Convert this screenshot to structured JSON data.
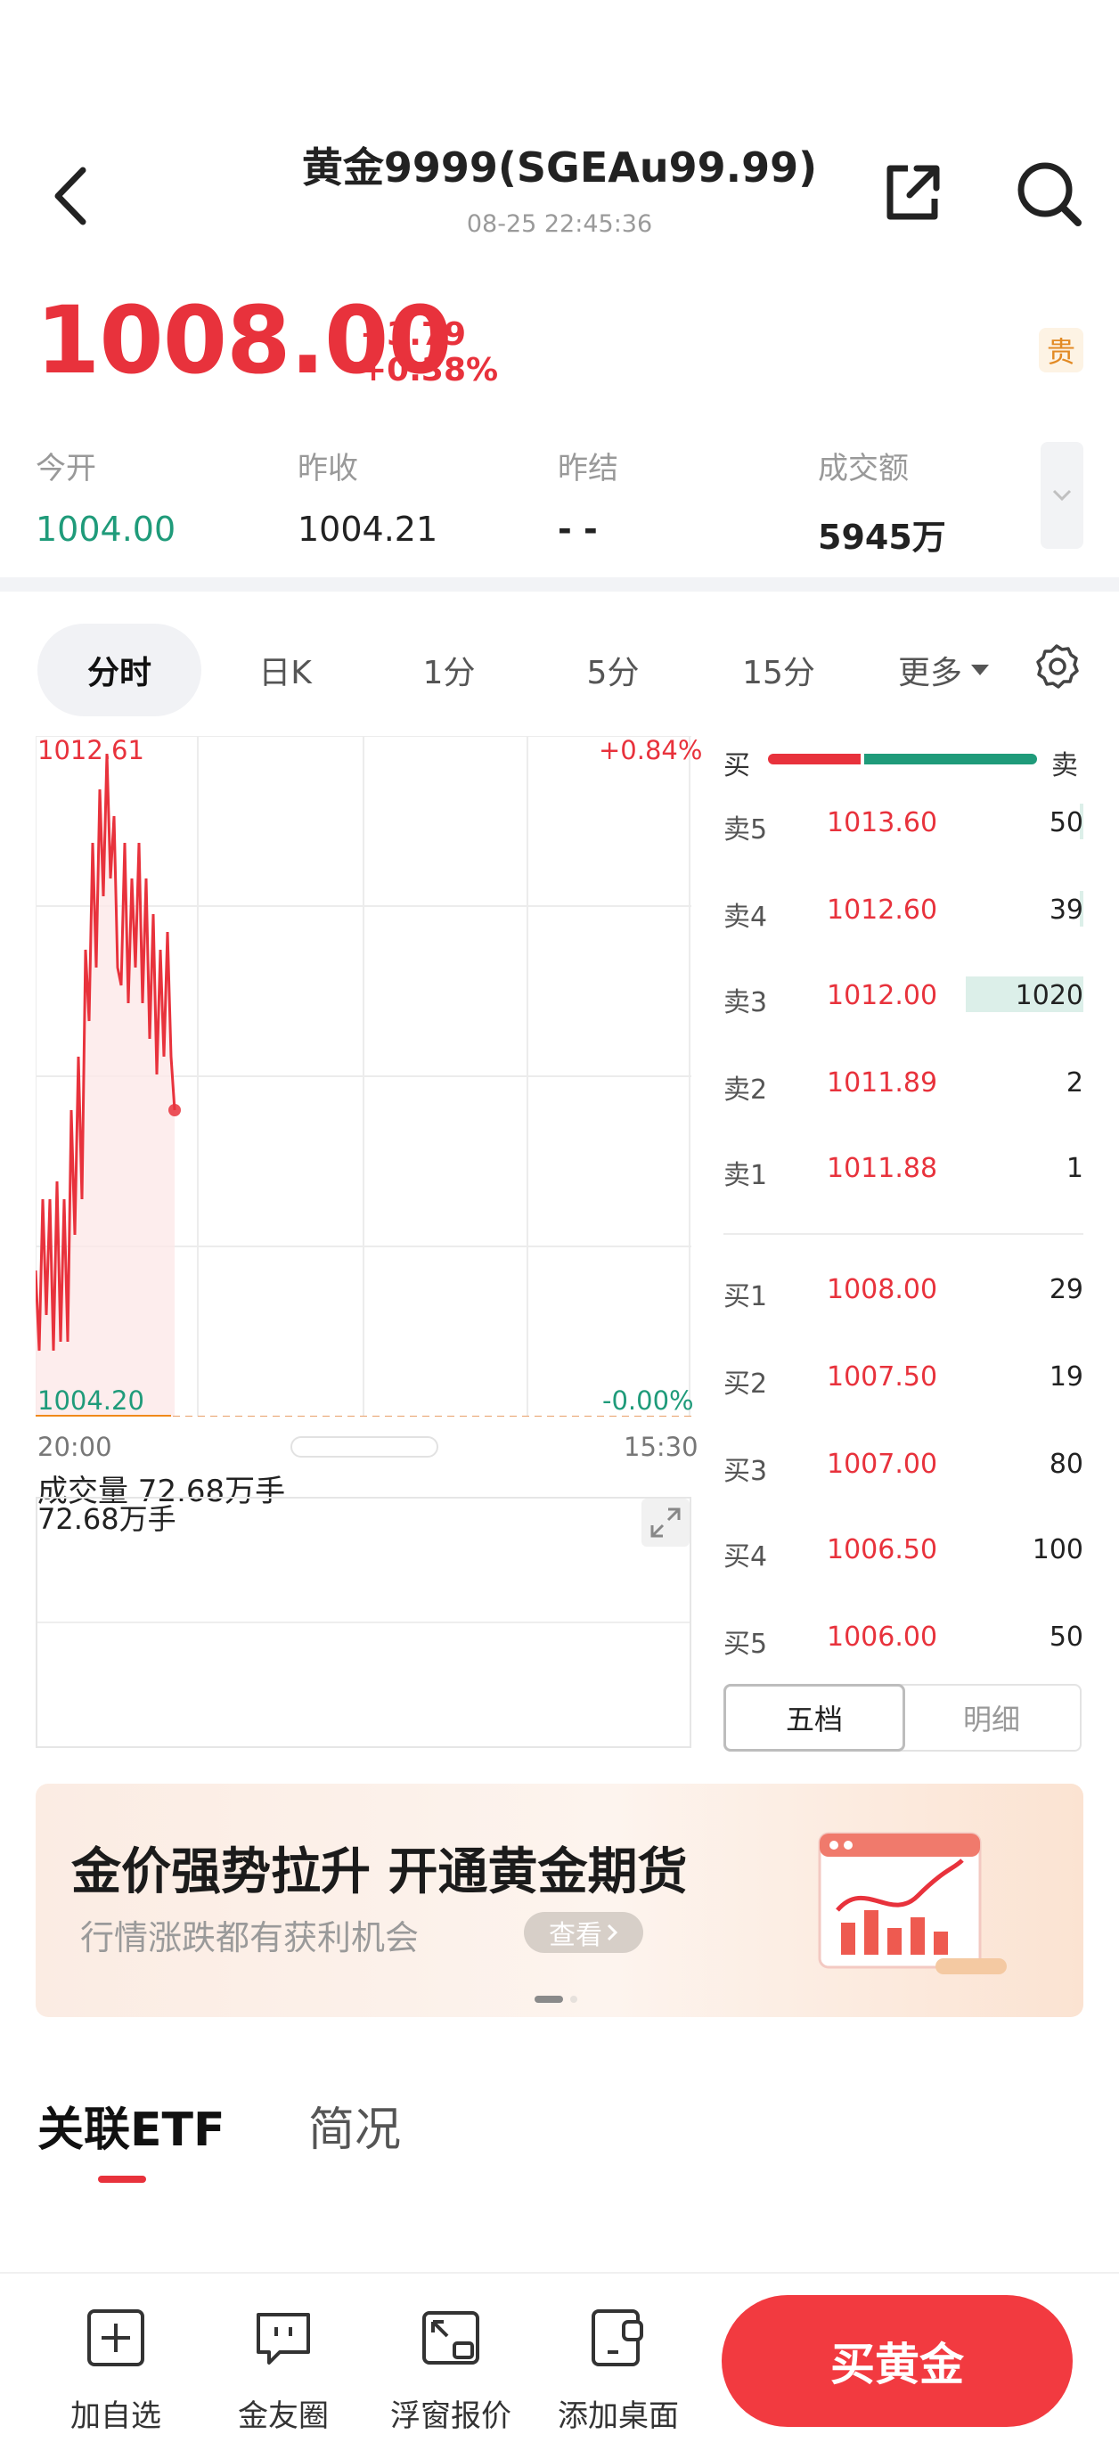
{
  "header": {
    "title": "黄金9999(SGEAu99.99)",
    "time": "08-25 22:45:36"
  },
  "quote": {
    "price": "1008.00",
    "change": "+3.79",
    "change_pct": "+0.38%",
    "badge": "贵",
    "price_color": "#e8323c"
  },
  "stats": [
    {
      "label": "今开",
      "value": "1004.00"
    },
    {
      "label": "昨收",
      "value": "1004.21"
    },
    {
      "label": "昨结",
      "value": "- -"
    },
    {
      "label": "成交额",
      "value": "5945万"
    }
  ],
  "tabs": [
    "分时",
    "日K",
    "1分",
    "5分",
    "15分",
    "更多"
  ],
  "chart": {
    "high_label": "1012.61",
    "high_pct": "+0.84%",
    "low_label": "1004.20",
    "low_pct": "-0.00%",
    "time_start": "20:00",
    "time_end": "15:30",
    "volume_title": "成交量 72.68万手",
    "volume_value": "72.68万手"
  },
  "orderbook": {
    "buy_label": "买",
    "sell_label": "卖",
    "asks": [
      {
        "label": "卖5",
        "price": "1013.60",
        "volume": "50",
        "depth": 0.05
      },
      {
        "label": "卖4",
        "price": "1012.60",
        "volume": "39",
        "depth": 0.04
      },
      {
        "label": "卖3",
        "price": "1012.00",
        "volume": "1020",
        "depth": 1.0
      },
      {
        "label": "卖2",
        "price": "1011.89",
        "volume": "2",
        "depth": 0.01
      },
      {
        "label": "卖1",
        "price": "1011.88",
        "volume": "1",
        "depth": 0.01
      }
    ],
    "bids": [
      {
        "label": "买1",
        "price": "1008.00",
        "volume": "29"
      },
      {
        "label": "买2",
        "price": "1007.50",
        "volume": "19"
      },
      {
        "label": "买3",
        "price": "1007.00",
        "volume": "80"
      },
      {
        "label": "买4",
        "price": "1006.50",
        "volume": "100"
      },
      {
        "label": "买5",
        "price": "1006.00",
        "volume": "50"
      }
    ],
    "toggle": [
      "五档",
      "明细"
    ]
  },
  "banner": {
    "title": "金价强势拉升 开通黄金期货",
    "subtitle": "行情涨跌都有获利机会",
    "button": "查看"
  },
  "sections": [
    "关联ETF",
    "简况"
  ],
  "bottom_nav": [
    {
      "label": "加自选",
      "icon": "add-watchlist-icon"
    },
    {
      "label": "金友圈",
      "icon": "chat-icon"
    },
    {
      "label": "浮窗报价",
      "icon": "float-window-icon"
    },
    {
      "label": "添加桌面",
      "icon": "add-desktop-icon"
    }
  ],
  "buy_button": "买黄金"
}
